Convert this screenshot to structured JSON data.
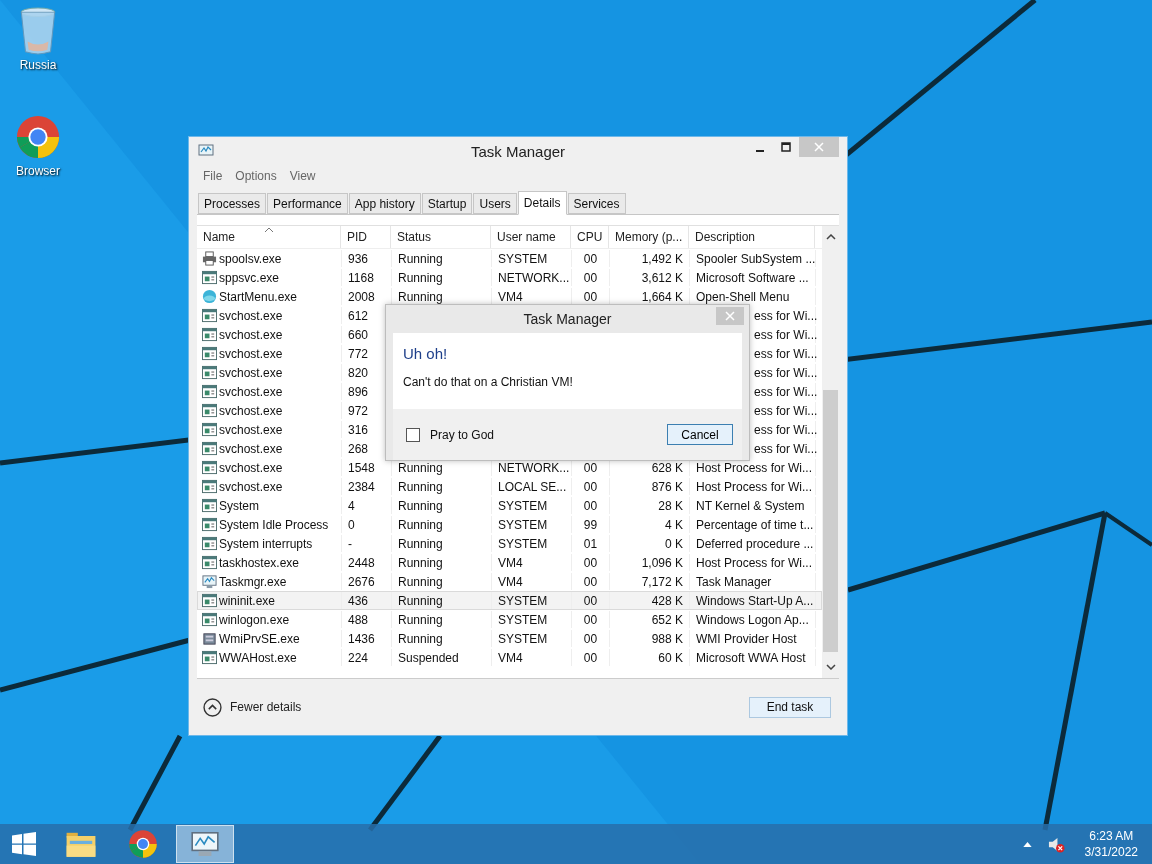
{
  "desktop_icons": [
    {
      "kind": "bin",
      "label": "Russia"
    },
    {
      "kind": "chrome",
      "label": "Browser"
    }
  ],
  "window": {
    "title": "Task Manager",
    "menu": [
      "File",
      "Options",
      "View"
    ],
    "tabs": [
      {
        "label": "Processes",
        "selected": false
      },
      {
        "label": "Performance",
        "selected": false
      },
      {
        "label": "App history",
        "selected": false
      },
      {
        "label": "Startup",
        "selected": false
      },
      {
        "label": "Users",
        "selected": false
      },
      {
        "label": "Details",
        "selected": true
      },
      {
        "label": "Services",
        "selected": false
      }
    ],
    "table": {
      "columns": [
        "Name",
        "PID",
        "Status",
        "User name",
        "CPU",
        "Memory (p...",
        "Description"
      ],
      "rows": [
        {
          "kind": "printer",
          "name": "spoolsv.exe",
          "pid": "936",
          "status": "Running",
          "user": "SYSTEM",
          "cpu": "00",
          "memory": "1,492 K",
          "description": "Spooler SubSystem ...",
          "selected": false
        },
        {
          "kind": "app",
          "name": "sppsvc.exe",
          "pid": "1168",
          "status": "Running",
          "user": "NETWORK...",
          "cpu": "00",
          "memory": "3,612 K",
          "description": "Microsoft Software ...",
          "selected": false
        },
        {
          "kind": "globe",
          "name": "StartMenu.exe",
          "pid": "2008",
          "status": "Running",
          "user": "VM4",
          "cpu": "00",
          "memory": "1,664 K",
          "description": "Open-Shell Menu",
          "selected": false
        },
        {
          "kind": "app",
          "name": "svchost.exe",
          "pid": "612",
          "description": "ess for Wi...",
          "selected": false
        },
        {
          "kind": "app",
          "name": "svchost.exe",
          "pid": "660",
          "description": "ess for Wi...",
          "selected": false
        },
        {
          "kind": "app",
          "name": "svchost.exe",
          "pid": "772",
          "description": "ess for Wi...",
          "selected": false
        },
        {
          "kind": "app",
          "name": "svchost.exe",
          "pid": "820",
          "description": "ess for Wi...",
          "selected": false
        },
        {
          "kind": "app",
          "name": "svchost.exe",
          "pid": "896",
          "description": "ess for Wi...",
          "selected": false
        },
        {
          "kind": "app",
          "name": "svchost.exe",
          "pid": "972",
          "description": "ess for Wi...",
          "selected": false
        },
        {
          "kind": "app",
          "name": "svchost.exe",
          "pid": "316",
          "description": "ess for Wi...",
          "selected": false
        },
        {
          "kind": "app",
          "name": "svchost.exe",
          "pid": "268",
          "description": "ess for Wi...",
          "selected": false
        },
        {
          "kind": "app",
          "name": "svchost.exe",
          "pid": "1548",
          "status": "Running",
          "user": "NETWORK...",
          "cpu": "00",
          "memory": "628 K",
          "description": "Host Process for Wi...",
          "selected": false
        },
        {
          "kind": "app",
          "name": "svchost.exe",
          "pid": "2384",
          "status": "Running",
          "user": "LOCAL SE...",
          "cpu": "00",
          "memory": "876 K",
          "description": "Host Process for Wi...",
          "selected": false
        },
        {
          "kind": "app",
          "name": "System",
          "pid": "4",
          "status": "Running",
          "user": "SYSTEM",
          "cpu": "00",
          "memory": "28 K",
          "description": "NT Kernel & System",
          "selected": false
        },
        {
          "kind": "app",
          "name": "System Idle Process",
          "pid": "0",
          "status": "Running",
          "user": "SYSTEM",
          "cpu": "99",
          "memory": "4 K",
          "description": "Percentage of time t...",
          "selected": false
        },
        {
          "kind": "app",
          "name": "System interrupts",
          "pid": "-",
          "status": "Running",
          "user": "SYSTEM",
          "cpu": "01",
          "memory": "0 K",
          "description": "Deferred procedure ...",
          "selected": false
        },
        {
          "kind": "app",
          "name": "taskhostex.exe",
          "pid": "2448",
          "status": "Running",
          "user": "VM4",
          "cpu": "00",
          "memory": "1,096 K",
          "description": "Host Process for Wi...",
          "selected": false
        },
        {
          "kind": "monitor",
          "name": "Taskmgr.exe",
          "pid": "2676",
          "status": "Running",
          "user": "VM4",
          "cpu": "00",
          "memory": "7,172 K",
          "description": "Task Manager",
          "selected": false
        },
        {
          "kind": "app",
          "name": "wininit.exe",
          "pid": "436",
          "status": "Running",
          "user": "SYSTEM",
          "cpu": "00",
          "memory": "428 K",
          "description": "Windows Start-Up A...",
          "selected": true
        },
        {
          "kind": "app",
          "name": "winlogon.exe",
          "pid": "488",
          "status": "Running",
          "user": "SYSTEM",
          "cpu": "00",
          "memory": "652 K",
          "description": "Windows Logon Ap...",
          "selected": false
        },
        {
          "kind": "server",
          "name": "WmiPrvSE.exe",
          "pid": "1436",
          "status": "Running",
          "user": "SYSTEM",
          "cpu": "00",
          "memory": "988 K",
          "description": "WMI Provider Host",
          "selected": false
        },
        {
          "kind": "app",
          "name": "WWAHost.exe",
          "pid": "224",
          "status": "Suspended",
          "user": "VM4",
          "cpu": "00",
          "memory": "60 K",
          "description": "Microsoft WWA Host",
          "selected": false
        }
      ]
    },
    "footer": {
      "link": "Fewer details",
      "button": "End task"
    }
  },
  "dialog": {
    "title": "Task Manager",
    "heading": "Uh oh!",
    "message": "Can't do that on a Christian VM!",
    "checkbox": {
      "label": "Pray to God",
      "checked": false
    },
    "button": "Cancel"
  },
  "taskbar": {
    "apps": [
      {
        "kind": "folder",
        "active": false
      },
      {
        "kind": "chrome",
        "active": false
      },
      {
        "kind": "monitor",
        "active": true
      }
    ],
    "time": "6:23 AM",
    "date": "3/31/2022"
  }
}
